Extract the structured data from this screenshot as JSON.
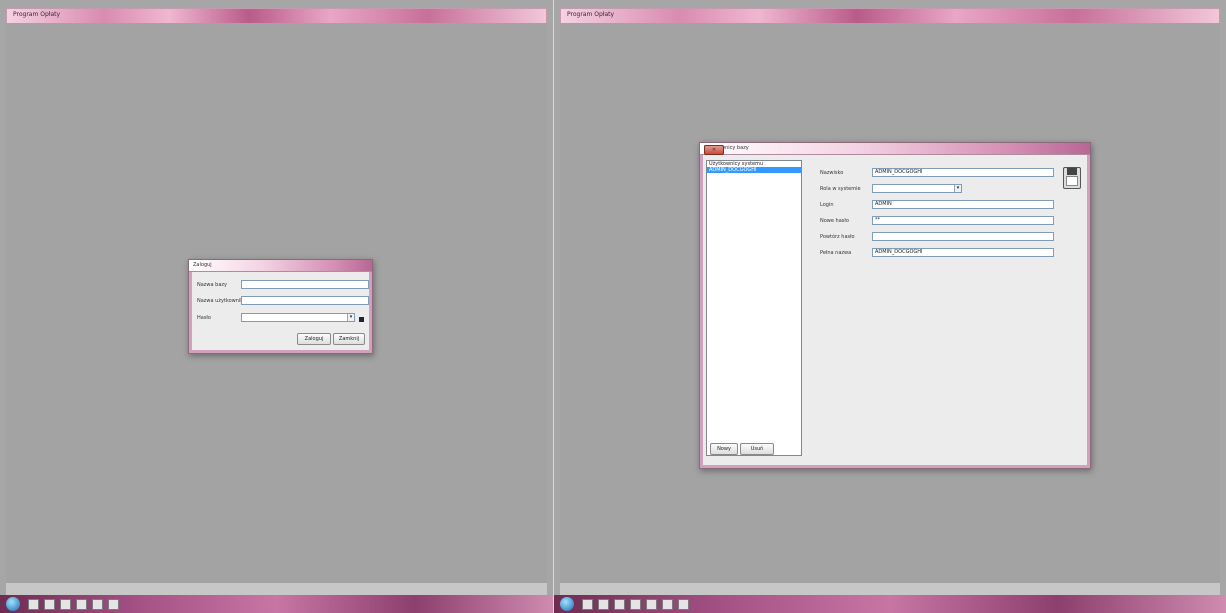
{
  "left_window": {
    "title": "Program Opłaty",
    "dialog": {
      "title": "Zaloguj",
      "fields": [
        {
          "label": "Nazwa bazy",
          "value": ""
        },
        {
          "label": "Nazwa użytkownika",
          "value": ""
        },
        {
          "label": "Hasło",
          "value": ""
        }
      ],
      "ok_label": "Zaloguj",
      "cancel_label": "Zamknij"
    }
  },
  "right_window": {
    "title": "Program Opłaty",
    "dialog": {
      "title": "Użytkownicy bazy",
      "list_items": [
        "Użytkownicy systemu",
        "ADMIN_DOCGOGHI"
      ],
      "selected_index": 1,
      "fields": [
        {
          "label": "Nazwisko",
          "value": "ADMIN_DOCGOGHI"
        },
        {
          "label": "Rola w systemie",
          "value": ""
        },
        {
          "label": "Login",
          "value": "ADMIN"
        },
        {
          "label": "Nowe hasło",
          "value": "**"
        },
        {
          "label": "Powtórz hasło",
          "value": ""
        },
        {
          "label": "Pełna nazwa",
          "value": "ADMIN_DOCGOGHI"
        }
      ],
      "add_label": "Nowy",
      "delete_label": "Usuń"
    }
  },
  "taskbar": {
    "clock_left": "",
    "clock_right": ""
  }
}
